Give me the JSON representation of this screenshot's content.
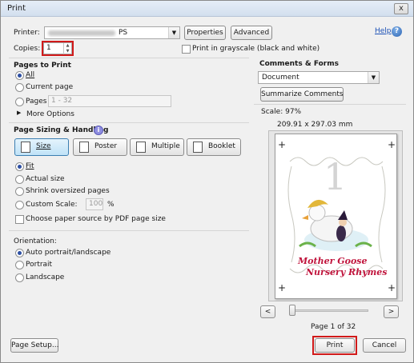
{
  "window": {
    "title": "Print",
    "close_glyph": "x"
  },
  "header": {
    "printer_label": "Printer:",
    "printer_value": "PS",
    "properties_label": "Properties",
    "advanced_label": "Advanced",
    "help_label": "Help",
    "copies_label": "Copies:",
    "copies_value": "1",
    "grayscale_label": "Print in grayscale (black and white)"
  },
  "pages_to_print": {
    "title": "Pages to Print",
    "all_label": "All",
    "current_label": "Current page",
    "pages_label": "Pages",
    "pages_value": "1 - 32",
    "more_options_label": "More Options",
    "selected": "All"
  },
  "sizing": {
    "title": "Page Sizing & Handling",
    "info_glyph": "i",
    "modes": [
      {
        "label": "Size",
        "active": true
      },
      {
        "label": "Poster",
        "active": false
      },
      {
        "label": "Multiple",
        "active": false
      },
      {
        "label": "Booklet",
        "active": false
      }
    ],
    "fit_label": "Fit",
    "actual_label": "Actual size",
    "shrink_label": "Shrink oversized pages",
    "custom_label": "Custom Scale:",
    "custom_value": "100",
    "custom_unit": "%",
    "source_label": "Choose paper source by PDF page size",
    "selected": "Fit"
  },
  "orientation": {
    "title": "Orientation:",
    "auto_label": "Auto portrait/landscape",
    "portrait_label": "Portrait",
    "landscape_label": "Landscape",
    "selected": "Auto portrait/landscape"
  },
  "comments": {
    "title": "Comments & Forms",
    "value": "Document",
    "summarize_label": "Summarize Comments"
  },
  "preview": {
    "scale_text": "Scale: 97%",
    "dimensions_text": "209.91 x 297.03 mm",
    "page_numeral": "1",
    "book_line1": "Mother Goose",
    "book_line2": "Nursery Rhymes",
    "slider_position": 0,
    "prev_glyph": "<",
    "next_glyph": ">",
    "page_indicator": "Page 1 of 32"
  },
  "footer": {
    "page_setup_label": "Page Setup...",
    "print_label": "Print",
    "cancel_label": "Cancel"
  },
  "colors": {
    "highlight": "#d11a1a",
    "book_title": "#c0143c",
    "link": "#1a4fb5"
  },
  "icons": [
    "close-icon",
    "help-icon",
    "info-icon",
    "size-icon",
    "poster-icon",
    "multiple-icon",
    "booklet-icon",
    "chevron-down-icon",
    "triangle-right-icon"
  ]
}
